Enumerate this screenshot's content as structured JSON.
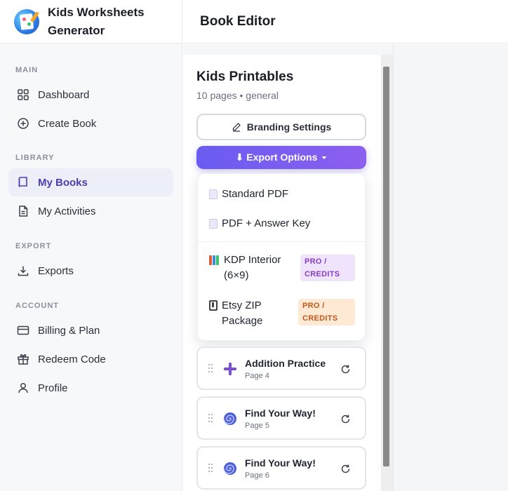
{
  "app": {
    "title": "Kids Worksheets Generator"
  },
  "header": {
    "title": "Book Editor"
  },
  "sidebar": {
    "sections": [
      {
        "label": "MAIN",
        "items": [
          {
            "label": "Dashboard",
            "icon": "dashboard-icon"
          },
          {
            "label": "Create Book",
            "icon": "plus-circle-icon"
          }
        ]
      },
      {
        "label": "LIBRARY",
        "items": [
          {
            "label": "My Books",
            "icon": "book-icon",
            "active": true
          },
          {
            "label": "My Activities",
            "icon": "document-icon"
          }
        ]
      },
      {
        "label": "EXPORT",
        "items": [
          {
            "label": "Exports",
            "icon": "download-icon"
          }
        ]
      },
      {
        "label": "ACCOUNT",
        "items": [
          {
            "label": "Billing & Plan",
            "icon": "credit-card-icon"
          },
          {
            "label": "Redeem Code",
            "icon": "gift-icon"
          },
          {
            "label": "Profile",
            "icon": "user-icon"
          }
        ]
      }
    ]
  },
  "book": {
    "title": "Kids Printables",
    "meta": "10 pages • general",
    "branding_label": "Branding Settings",
    "export_label": "⬇ Export Options"
  },
  "export_menu": {
    "items": [
      {
        "label": "Standard PDF",
        "icon": "document-icon"
      },
      {
        "label": "PDF + Answer Key",
        "icon": "document-icon"
      },
      {
        "label": "KDP Interior (6×9)",
        "icon": "books-icon",
        "badge": "PRO / CREDITS",
        "badge_color": "#8a3cc4"
      },
      {
        "label": "Etsy ZIP Package",
        "icon": "zip-icon",
        "badge": "PRO / CREDITS",
        "badge_color": "#c2571a"
      }
    ]
  },
  "pages": [
    {
      "title": "Addition Practice",
      "subtitle": "Page 4",
      "icon": "plus-icon"
    },
    {
      "title": "Find Your Way!",
      "subtitle": "Page 5",
      "icon": "spiral-icon"
    },
    {
      "title": "Find Your Way!",
      "subtitle": "Page 6",
      "icon": "spiral-icon"
    }
  ],
  "colors": {
    "accent": "#6a5cf0",
    "active_nav_bg": "#eceef8"
  }
}
